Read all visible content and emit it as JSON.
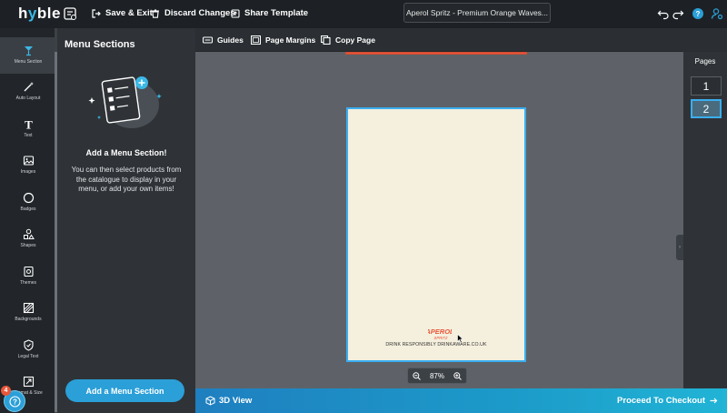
{
  "app": {
    "logo_text_a": "h",
    "logo_text_b": "y",
    "logo_text_c": "ble"
  },
  "topbar": {
    "save_exit": "Save & Exit",
    "discard": "Discard Changes",
    "share": "Share Template",
    "template_title": "Aperol Spritz - Premium Orange Waves..."
  },
  "rail": {
    "items": [
      {
        "label": "Menu Section",
        "icon": "cocktail-icon"
      },
      {
        "label": "Auto Layout",
        "icon": "magic-wand-icon"
      },
      {
        "label": "Text",
        "icon": "text-icon"
      },
      {
        "label": "Images",
        "icon": "image-icon"
      },
      {
        "label": "Badges",
        "icon": "badge-icon"
      },
      {
        "label": "Shapes",
        "icon": "shapes-icon"
      },
      {
        "label": "Themes",
        "icon": "theme-icon"
      },
      {
        "label": "Backgrounds",
        "icon": "background-icon"
      },
      {
        "label": "Legal Text",
        "icon": "shield-icon"
      },
      {
        "label": "Format & Size",
        "icon": "resize-icon"
      }
    ]
  },
  "panel": {
    "title": "Menu Sections",
    "heading": "Add a Menu Section!",
    "description": "You can then select products from the catalogue to display in your menu, or add your own items!",
    "add_button": "Add a Menu Section"
  },
  "canvas_toolbar": {
    "guides": "Guides",
    "margins": "Page Margins",
    "copy": "Copy Page"
  },
  "page": {
    "brand_line1": "APEROL",
    "brand_line2": "SPRITZ",
    "footer": "DRINK RESPONSIBLY DRINKAWARE.CO.UK"
  },
  "zoom": {
    "level": "87%"
  },
  "pages": {
    "title": "Pages",
    "items": [
      "1",
      "2"
    ],
    "active": "2"
  },
  "bottombar": {
    "view3d": "3D View",
    "checkout": "Proceed To Checkout"
  },
  "help": {
    "badge_count": "4"
  },
  "colors": {
    "accent": "#2b9fd8",
    "selection": "#3aaef0",
    "brand_orange": "#e8563a"
  }
}
